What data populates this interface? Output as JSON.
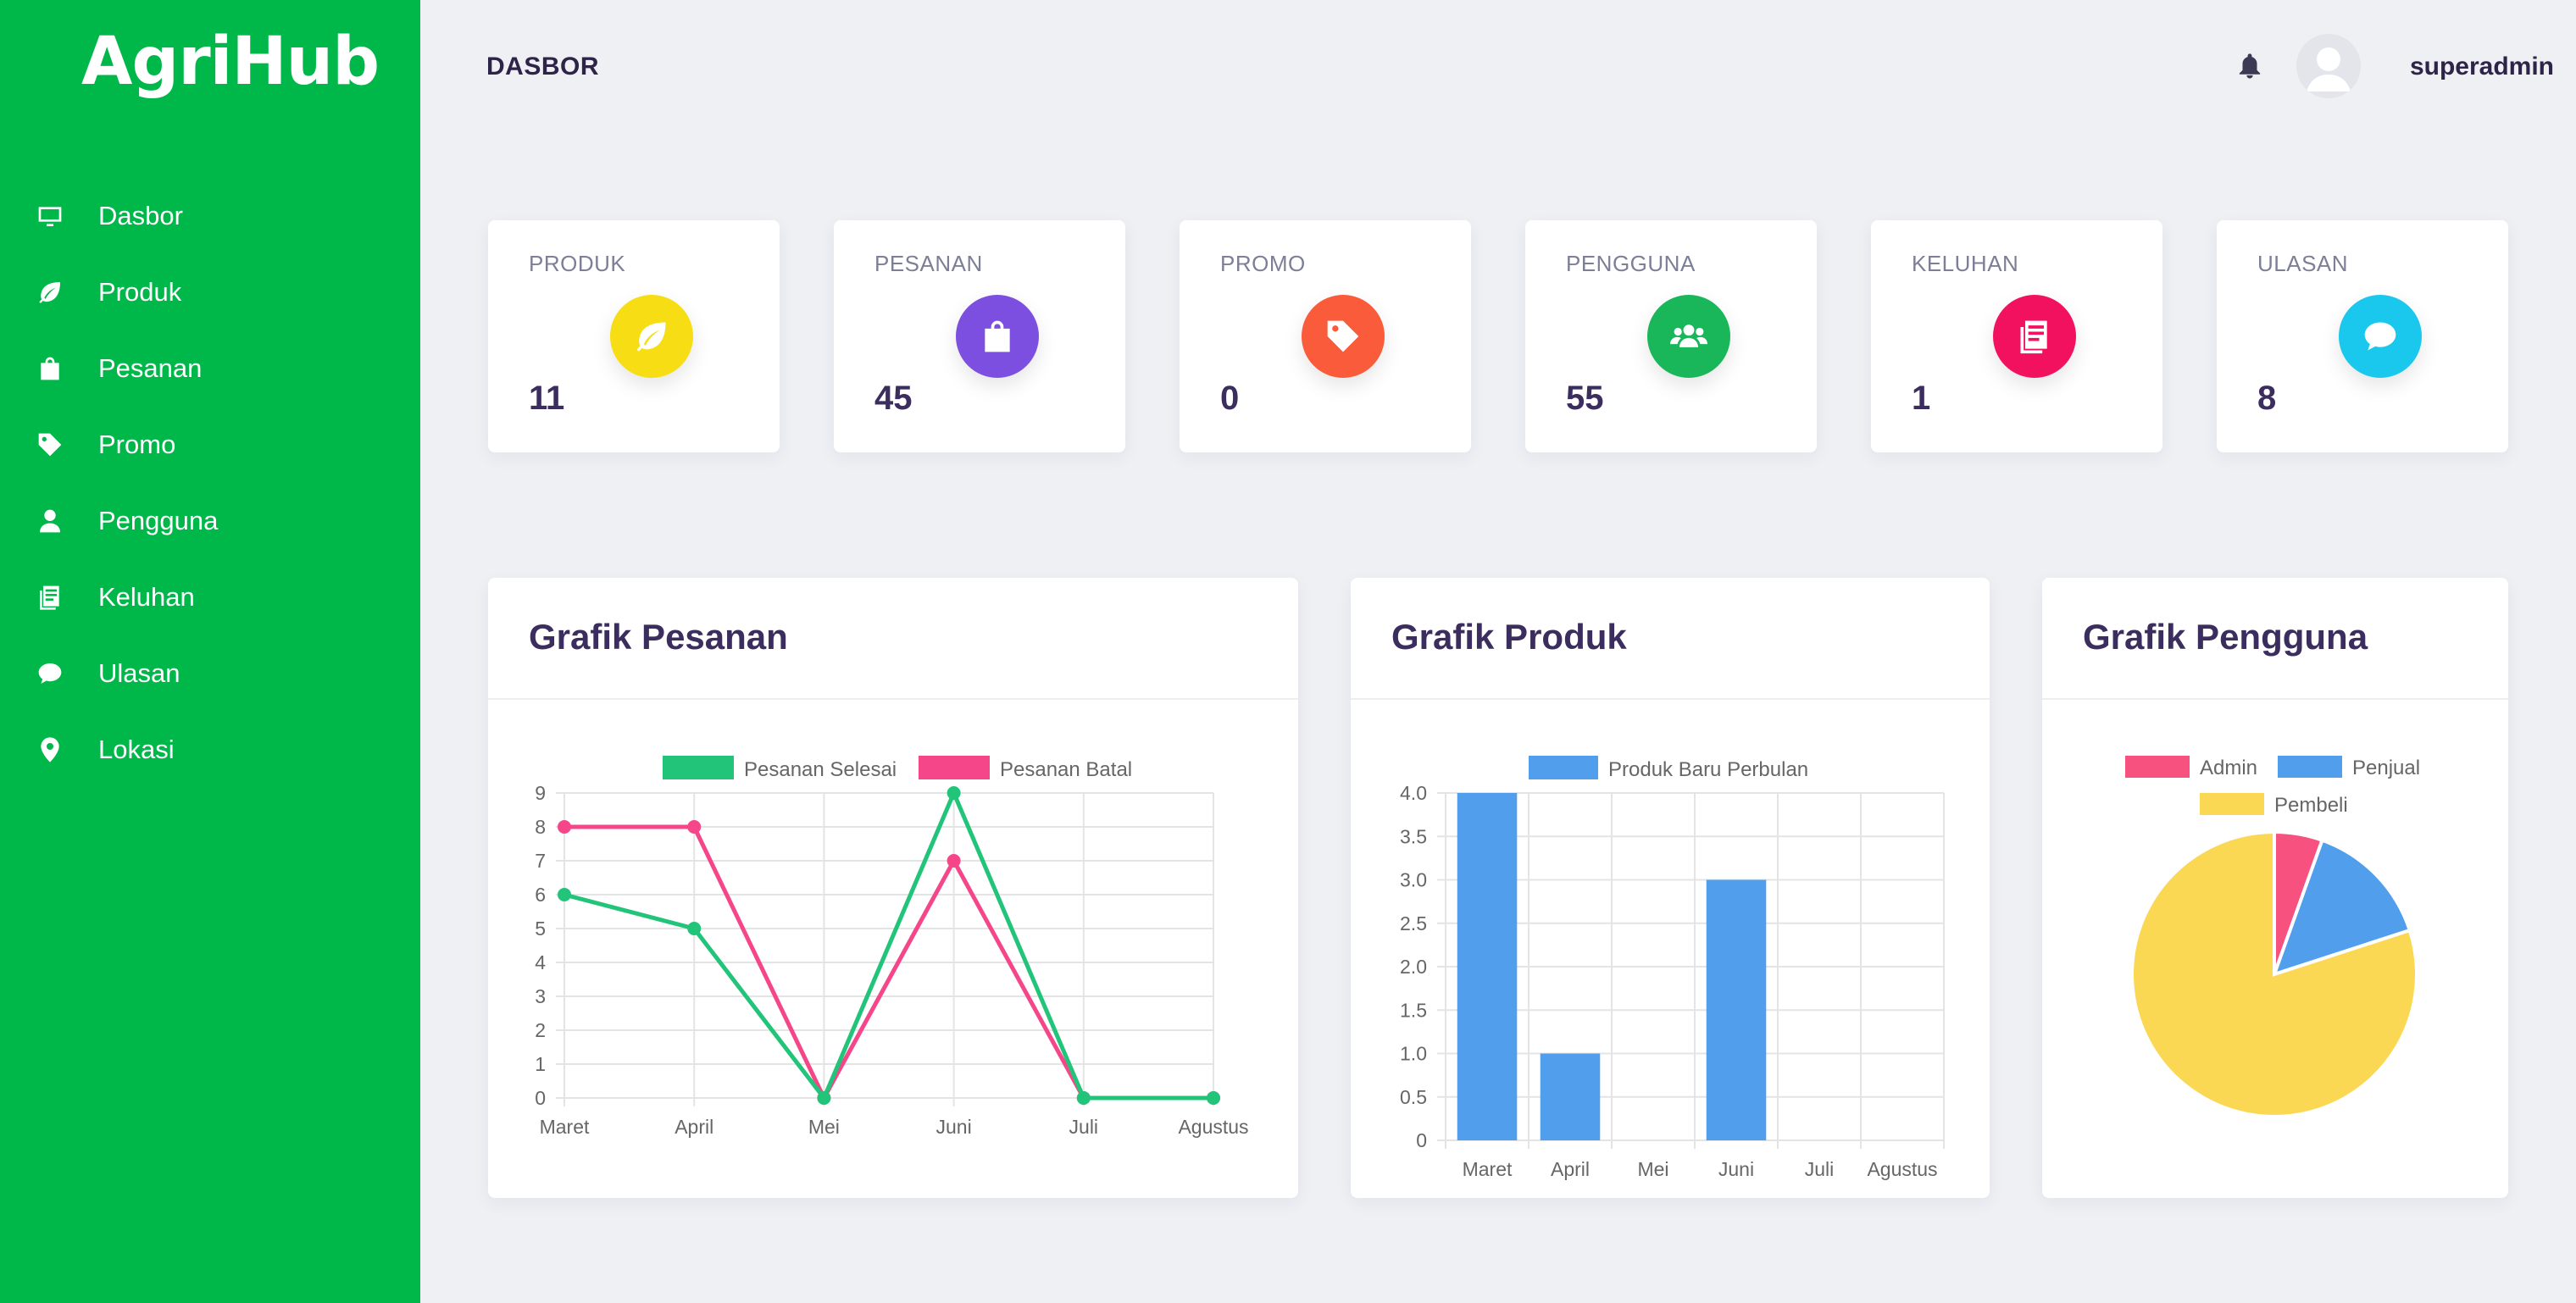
{
  "app": {
    "logo": "AgriHub"
  },
  "sidebar": {
    "items": [
      {
        "label": "Dasbor",
        "icon": "monitor-icon"
      },
      {
        "label": "Produk",
        "icon": "leaf-icon"
      },
      {
        "label": "Pesanan",
        "icon": "shopping-bag-icon"
      },
      {
        "label": "Promo",
        "icon": "tag-icon"
      },
      {
        "label": "Pengguna",
        "icon": "user-icon"
      },
      {
        "label": "Keluhan",
        "icon": "document-icon"
      },
      {
        "label": "Ulasan",
        "icon": "chat-bubble-icon"
      },
      {
        "label": "Lokasi",
        "icon": "map-pin-icon"
      }
    ]
  },
  "header": {
    "title": "DASBOR",
    "username": "superadmin"
  },
  "stats": [
    {
      "label": "PRODUK",
      "value": "11",
      "icon": "leaf-icon",
      "color": "#f7de14"
    },
    {
      "label": "PESANAN",
      "value": "45",
      "icon": "shopping-bag-icon",
      "color": "#7c4fe0"
    },
    {
      "label": "PROMO",
      "value": "0",
      "icon": "tag-icon",
      "color": "#fa5b3a"
    },
    {
      "label": "PENGGUNA",
      "value": "55",
      "icon": "users-icon",
      "color": "#19b65a"
    },
    {
      "label": "KELUHAN",
      "value": "1",
      "icon": "document-icon",
      "color": "#f2115f"
    },
    {
      "label": "ULASAN",
      "value": "8",
      "icon": "chat-bubble-icon",
      "color": "#1ac8ee"
    }
  ],
  "charts": {
    "pesanan_title": "Grafik Pesanan",
    "produk_title": "Grafik Produk",
    "pengguna_title": "Grafik Pengguna"
  },
  "chart_data": [
    {
      "type": "line",
      "title": "Grafik Pesanan",
      "categories": [
        "Maret",
        "April",
        "Mei",
        "Juni",
        "Juli",
        "Agustus"
      ],
      "ylim": [
        0,
        9
      ],
      "yticks": [
        0,
        1,
        2,
        3,
        4,
        5,
        6,
        7,
        8,
        9
      ],
      "grid": true,
      "legend": "top",
      "series": [
        {
          "name": "Pesanan Selesai",
          "color": "#22c47a",
          "values": [
            6,
            5,
            0,
            9,
            0,
            0
          ]
        },
        {
          "name": "Pesanan Batal",
          "color": "#f5468a",
          "values": [
            8,
            8,
            0,
            7,
            0,
            0
          ]
        }
      ]
    },
    {
      "type": "bar",
      "title": "Grafik Produk",
      "categories": [
        "Maret",
        "April",
        "Mei",
        "Juni",
        "Juli",
        "Agustus"
      ],
      "ylim": [
        0,
        4
      ],
      "yticks": [
        "0",
        "0.5",
        "1.0",
        "1.5",
        "2.0",
        "2.5",
        "3.0",
        "3.5",
        "4.0"
      ],
      "grid": true,
      "legend": "top",
      "series": [
        {
          "name": "Produk Baru Perbulan",
          "color": "#509eec",
          "values": [
            4,
            1,
            0,
            3,
            0,
            0
          ]
        }
      ]
    },
    {
      "type": "pie",
      "title": "Grafik Pengguna",
      "legend": "top",
      "categories": [
        "Admin",
        "Penjual",
        "Pembeli"
      ],
      "colors": [
        "#f7517f",
        "#509eec",
        "#fbd854"
      ],
      "values": [
        3,
        8,
        44
      ]
    }
  ]
}
